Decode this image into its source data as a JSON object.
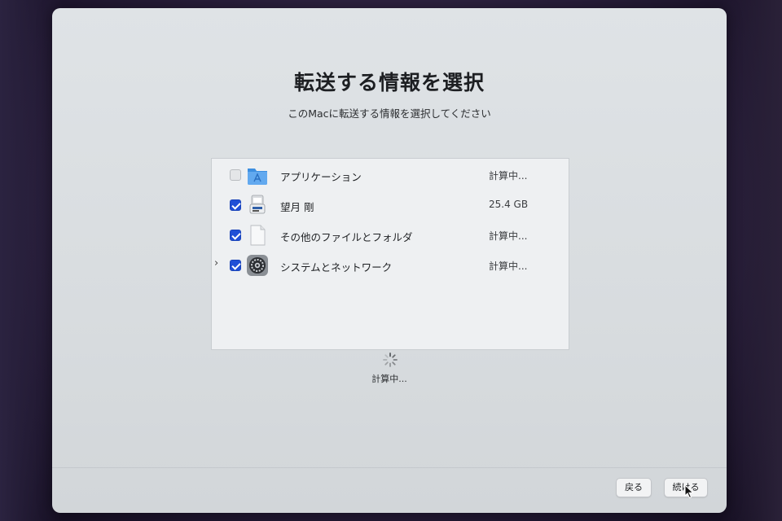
{
  "window": {
    "title": "転送する情報を選択",
    "subtitle": "このMacに転送する情報を選択してください"
  },
  "items": [
    {
      "label": "アプリケーション",
      "size": "計算中...",
      "checked": false,
      "expandable": false,
      "icon": "applications-folder-icon"
    },
    {
      "label": "望月 剛",
      "size": "25.4 GB",
      "checked": true,
      "expandable": false,
      "icon": "user-home-drive-icon"
    },
    {
      "label": "その他のファイルとフォルダ",
      "size": "計算中...",
      "checked": true,
      "expandable": false,
      "icon": "generic-document-icon"
    },
    {
      "label": "システムとネットワーク",
      "size": "計算中...",
      "checked": true,
      "expandable": true,
      "icon": "system-settings-gear-icon"
    }
  ],
  "status": {
    "text": "計算中..."
  },
  "buttons": {
    "back": "戻る",
    "continue": "続ける"
  },
  "colors": {
    "accent": "#1f4fd6",
    "window_bg": "#dcdfe2",
    "list_bg": "#eef0f2",
    "folder_blue": "#3d8fe0"
  }
}
